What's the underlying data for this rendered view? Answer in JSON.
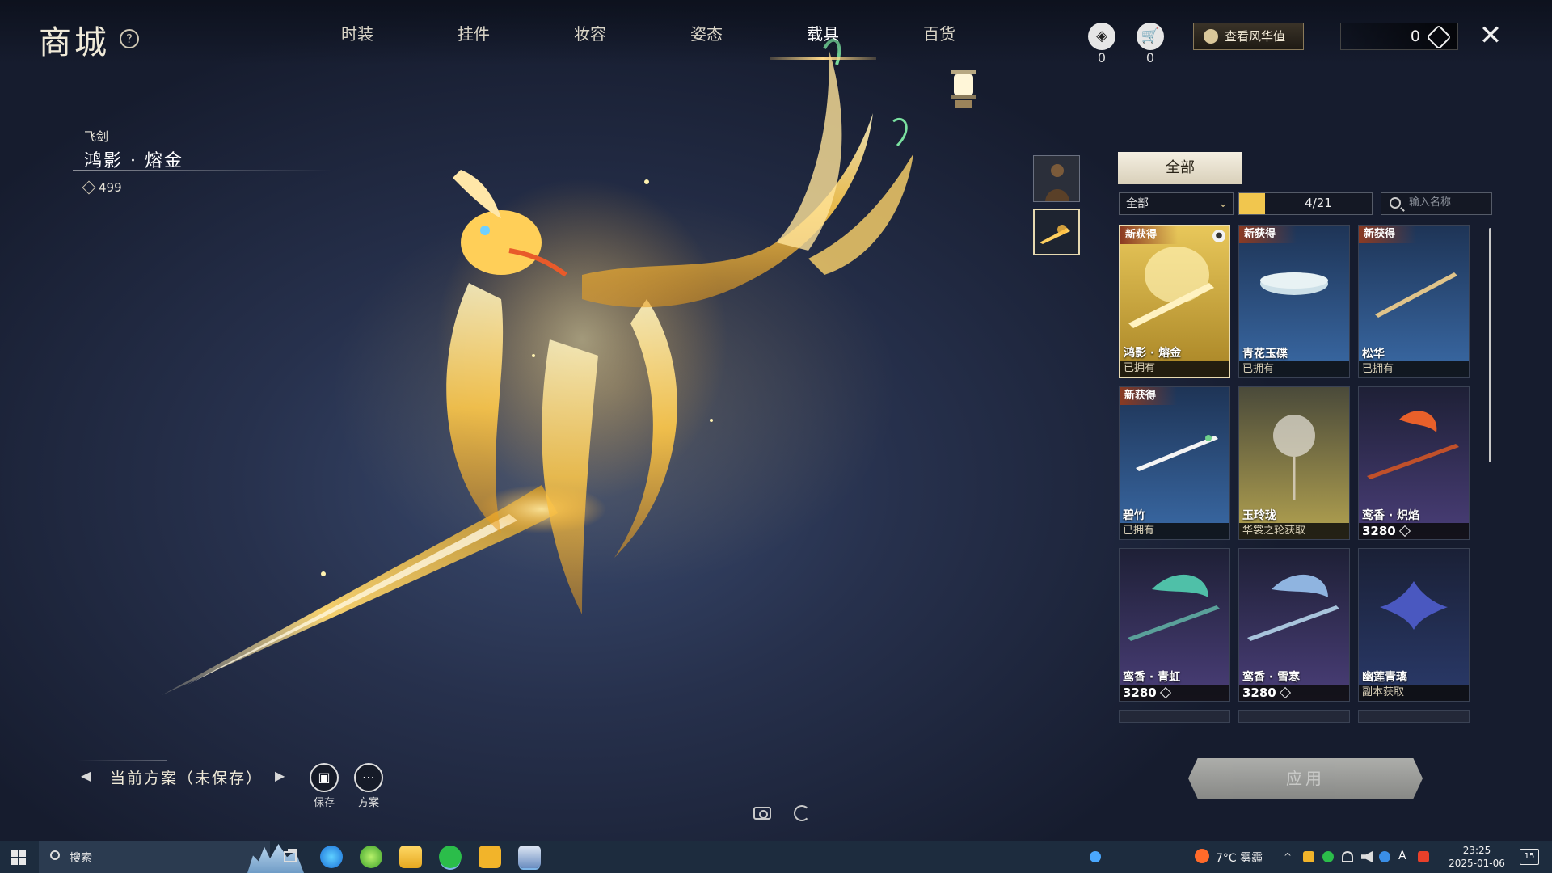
{
  "header": {
    "title": "商城",
    "help": "?",
    "tabs": [
      "时装",
      "挂件",
      "妆容",
      "姿态",
      "载具",
      "百货"
    ],
    "active_tab_index": 4,
    "storage_count": "0",
    "cart_count": "0",
    "view_button": "查看风华值",
    "currency_value": "0",
    "close": "✕"
  },
  "item": {
    "category": "飞剑",
    "name": "鸿影 · 熔金",
    "price": "499"
  },
  "filter": {
    "tab_all": "全部",
    "dropdown_value": "全部",
    "count": "4/21",
    "search_placeholder": "输入名称"
  },
  "cards": [
    {
      "name": "鸿影 · 熔金",
      "status": "已拥有",
      "badge": "新获得",
      "selected": true,
      "theme": "gold"
    },
    {
      "name": "青花玉碟",
      "status": "已拥有",
      "badge": "新获得",
      "theme": "blue"
    },
    {
      "name": "松华",
      "status": "已拥有",
      "badge": "新获得",
      "theme": "blue"
    },
    {
      "name": "碧竹",
      "status": "已拥有",
      "badge": "新获得",
      "theme": "blue"
    },
    {
      "name": "玉玲珑",
      "status": "华裳之轮获取",
      "badge": "",
      "theme": "olive"
    },
    {
      "name": "鸾香 · 炽焰",
      "price": "3280",
      "badge": "",
      "theme": "purple"
    },
    {
      "name": "鸾香 · 青虹",
      "price": "3280",
      "badge": "",
      "theme": "purple"
    },
    {
      "name": "鸾香 · 雪寒",
      "price": "3280",
      "badge": "",
      "theme": "purple"
    },
    {
      "name": "幽莲青璃",
      "status": "副本获取",
      "badge": "",
      "theme": "navy"
    }
  ],
  "apply_button": "应用",
  "plan": {
    "label": "当前方案（未保存）",
    "save_label": "保存",
    "scheme_label": "方案"
  },
  "taskbar": {
    "search_text": "搜索",
    "weather": "7°C 雾霾",
    "time": "23:25",
    "date": "2025-01-06",
    "notifications": "15",
    "ime": "A"
  },
  "colors": {
    "accent_gold": "#f1c64e",
    "new_badge": "#8c3a22",
    "card_gold": "#c9a63a",
    "card_blue": "#2f5a8e",
    "card_purple": "#3e3a6e"
  }
}
